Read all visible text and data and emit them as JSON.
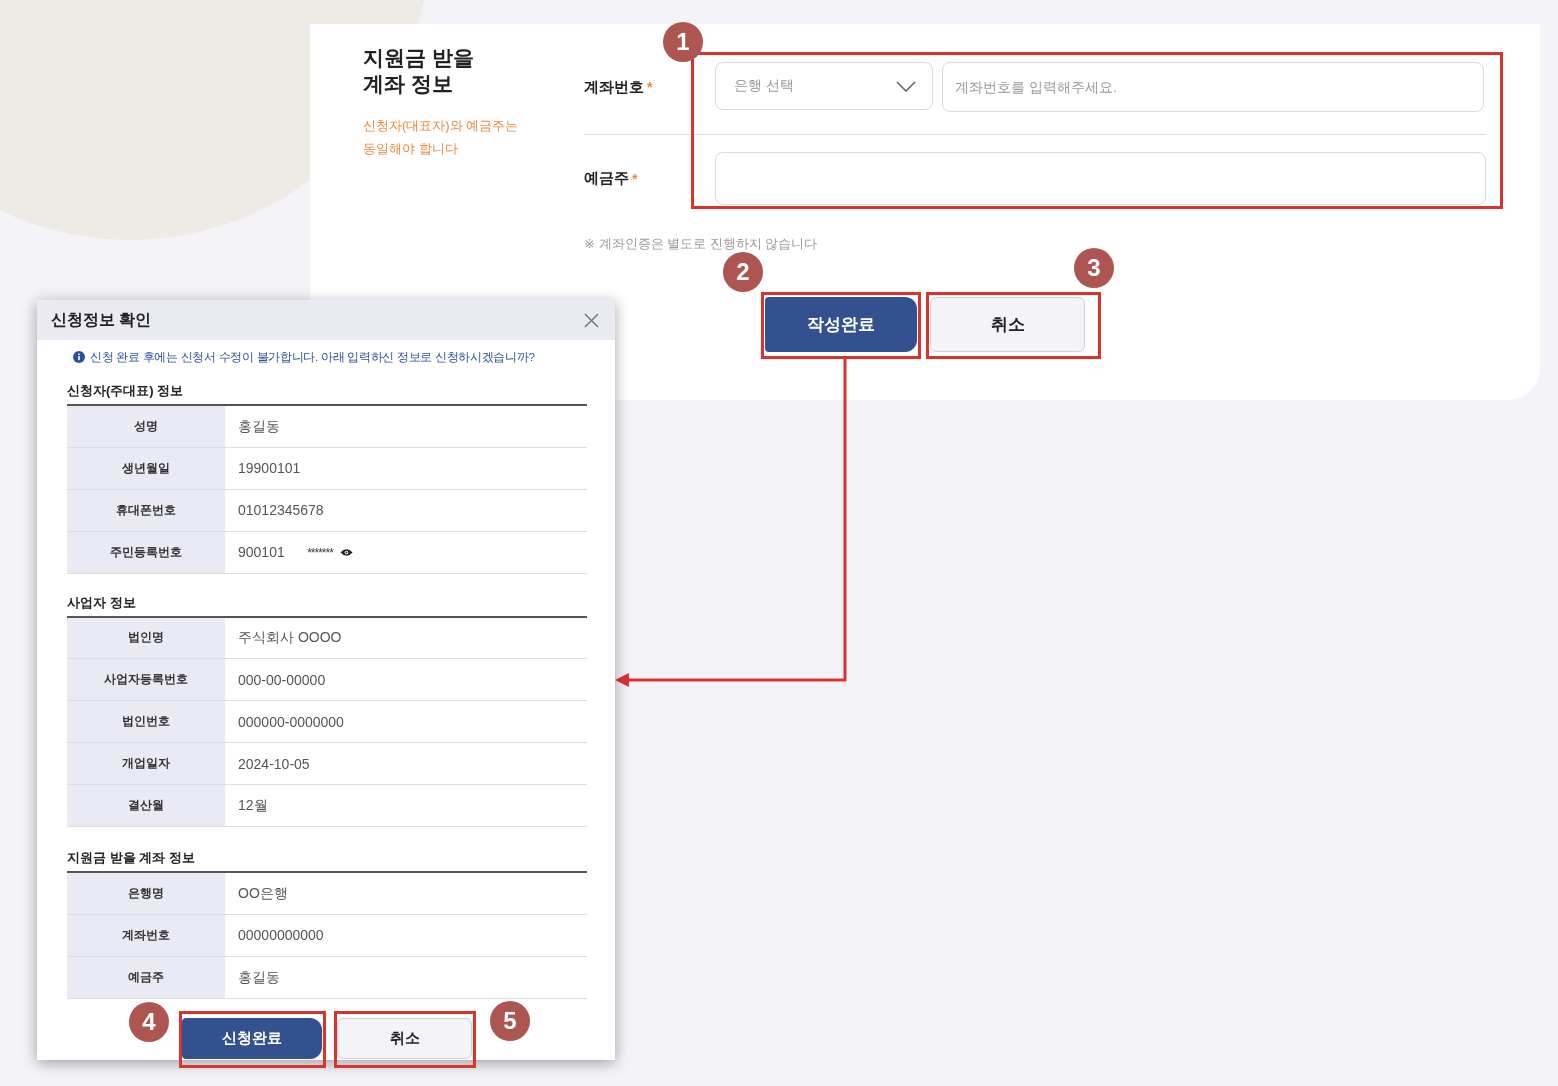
{
  "form": {
    "title_lines": [
      "지원금 받을",
      "계좌 정보"
    ],
    "hint_lines": [
      "신청자(대표자)와 예금주는",
      "동일해야 합니다"
    ],
    "badge": "1",
    "fields": [
      {
        "kind": "account",
        "label": "계좌번호",
        "required_mark": "*",
        "select_placeholder": "은행 선택",
        "placeholder": "계좌번호를 입력해주세요."
      },
      {
        "kind": "text",
        "label": "예금주",
        "required_mark": "*"
      }
    ],
    "note": "※ 계좌인증은 별도로 진행하지 않습니다",
    "buttons": [
      {
        "kind": "primary",
        "label": "작성완료",
        "badge": "2"
      },
      {
        "kind": "secondary",
        "label": "취소",
        "badge": "3"
      }
    ]
  },
  "dialog": {
    "title": "신청정보 확인",
    "notice": "신청 완료 후에는 신청서 수정이 불가합니다. 아래 입력하신 정보로 신청하시겠습니까?",
    "sections": [
      {
        "heading": "신청자(주대표) 정보",
        "rows": [
          {
            "label": "성명",
            "value": "홍길동"
          },
          {
            "label": "생년월일",
            "value": "19900101"
          },
          {
            "label": "휴대폰번호",
            "value": "01012345678"
          },
          {
            "label": "주민등록번호",
            "value": "900101",
            "masked": "*******"
          }
        ]
      },
      {
        "heading": "사업자 정보",
        "rows": [
          {
            "label": "법인명",
            "value": "주식회사 OOOO"
          },
          {
            "label": "사업자등록번호",
            "value": "000-00-00000"
          },
          {
            "label": "법인번호",
            "value": "000000-0000000"
          },
          {
            "label": "개업일자",
            "value": "2024-10-05"
          },
          {
            "label": "결산월",
            "value": "12월"
          }
        ]
      },
      {
        "heading": "지원금 받을 계좌 정보",
        "rows": [
          {
            "label": "은행명",
            "value": "OO은행"
          },
          {
            "label": "계좌번호",
            "value": "00000000000"
          },
          {
            "label": "예금주",
            "value": "홍길동"
          }
        ]
      }
    ],
    "buttons": [
      {
        "kind": "primary",
        "label": "신청완료",
        "badge": "4"
      },
      {
        "kind": "secondary",
        "label": "취소",
        "badge": "5"
      }
    ]
  }
}
